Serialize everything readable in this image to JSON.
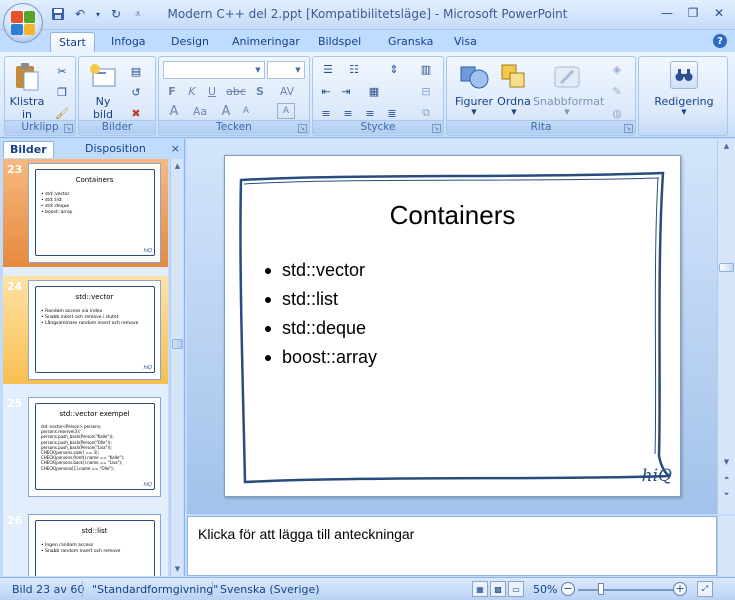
{
  "window": {
    "title": "Modern C++ del 2.ppt [Kompatibilitetsläge] - Microsoft PowerPoint",
    "minimize": "—",
    "maximize": "❐",
    "close": "✕"
  },
  "ribbon_tabs": [
    {
      "label": "Start",
      "active": true
    },
    {
      "label": "Infoga"
    },
    {
      "label": "Design"
    },
    {
      "label": "Animeringar"
    },
    {
      "label": "Bildspel"
    },
    {
      "label": "Granska"
    },
    {
      "label": "Visa"
    }
  ],
  "ribbon": {
    "groups": {
      "urklipp": "Urklipp",
      "bilder": "Bilder",
      "tecken": "Tecken",
      "stycke": "Stycke",
      "rita": "Rita"
    },
    "buttons": {
      "klistra_line1": "Klistra",
      "klistra_line2": "in",
      "ny_bild_line1": "Ny",
      "ny_bild_line2": "bild",
      "figurer": "Figurer",
      "ordna": "Ordna",
      "snabbformat": "Snabbformat",
      "redigering": "Redigering"
    },
    "font_buttons": {
      "bold": "F",
      "italic": "K",
      "underline": "U",
      "strike": "abc",
      "shadow": "S",
      "spacing": "AV",
      "case": "Aa",
      "grow": "A",
      "shrink": "A",
      "color": "A",
      "clear": "A"
    }
  },
  "left_pane": {
    "tabs": [
      "Bilder",
      "Disposition"
    ],
    "close": "×",
    "thumbnails": [
      {
        "number": "23",
        "title": "Containers",
        "lines": "• std::vector\n• std::list\n• std::deque\n• boost::array",
        "logo": "hiQ"
      },
      {
        "number": "24",
        "title": "std::vector",
        "lines": "• Random access via index\n• Snabb insert och remove i slutet\n• Långsammare random insert och remove",
        "logo": "hiQ"
      },
      {
        "number": "25",
        "title": "std::vector exempel",
        "lines": "std::vector<Person> persons;\npersons.reserve(3);\npersons.push_back(Person(\"Kalle\"));\npersons.push_back(Person(\"Olle\"));\npersons.push_back(Person(\"Lisa\"));\nCHECK(persons.size() == 3);\nCHECK(persons.front().name == \"Kalle\");\nCHECK(persons.back().name == \"Lisa\");\nCHECK(persons[1].name == \"Olle\");",
        "logo": "hiQ"
      },
      {
        "number": "26",
        "title": "std::list",
        "lines": "• Ingen random access\n• Snabb random insert och remove",
        "logo": ""
      }
    ]
  },
  "slide": {
    "title": "Containers",
    "bullets": [
      "std::vector",
      "std::list",
      "std::deque",
      "boost::array"
    ],
    "logo": "hiQ"
  },
  "notes": {
    "placeholder": "Klicka för att lägga till anteckningar"
  },
  "status": {
    "slide_position": "Bild 23 av 60",
    "theme": "\"Standardformgivning\"",
    "language": "Svenska (Sverige)",
    "zoom": "50%",
    "zoom_minus": "−",
    "zoom_plus": "+"
  },
  "colors": {
    "accent": "#15428b",
    "selected_thumb": "#e6893d",
    "hover_thumb": "#f7bf52",
    "slide_frame": "#284c7e"
  }
}
